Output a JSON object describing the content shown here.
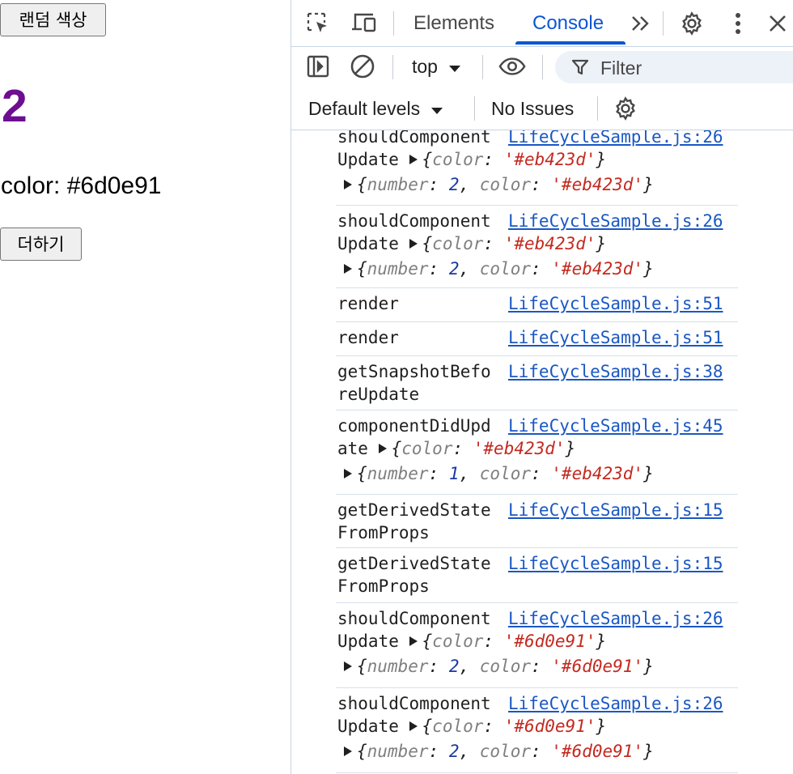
{
  "app": {
    "random_color_button": "랜덤 색상",
    "number": "2",
    "number_color": "#6d0e91",
    "color_label": "color: #6d0e91",
    "add_button": "더하기"
  },
  "devtools": {
    "tabs": [
      "Elements",
      "Console"
    ],
    "active_tab": "Console",
    "context": "top",
    "filter_placeholder": "Filter",
    "default_levels": "Default levels",
    "issues": "No Issues",
    "accent_color": "#0b57d0",
    "icons": [
      "inspect-element-icon",
      "device-toolbar-icon",
      "more-tabs-icon",
      "settings-icon",
      "more-options-icon",
      "close-icon",
      "sidebar-toggle-icon",
      "clear-console-icon",
      "live-expression-eye-icon",
      "filter-icon",
      "console-settings-icon"
    ]
  },
  "console": {
    "messages": [
      {
        "kind": "shouldComponentUpdate",
        "line1": "shouldComponent",
        "line2": "Update",
        "source": "LifeCycleSample.js:26",
        "props_obj": {
          "key": "color",
          "value": "'#eb423d'"
        },
        "state_obj": [
          {
            "key": "number",
            "value": "2"
          },
          {
            "key": "color",
            "value": "'#eb423d'"
          }
        ]
      },
      {
        "kind": "shouldComponentUpdate",
        "line1": "shouldComponent",
        "line2": "Update",
        "source": "LifeCycleSample.js:26",
        "props_obj": {
          "key": "color",
          "value": "'#eb423d'"
        },
        "state_obj": [
          {
            "key": "number",
            "value": "2"
          },
          {
            "key": "color",
            "value": "'#eb423d'"
          }
        ]
      },
      {
        "kind": "render",
        "line1": "render",
        "source": "LifeCycleSample.js:51"
      },
      {
        "kind": "render",
        "line1": "render",
        "source": "LifeCycleSample.js:51"
      },
      {
        "kind": "getSnapshotBeforeUpdate",
        "line1": "getSnapshotBefo",
        "line2": "reUpdate",
        "source": "LifeCycleSample.js:38"
      },
      {
        "kind": "componentDidUpdate",
        "line1": "componentDidUpd",
        "line2": "ate",
        "source": "LifeCycleSample.js:45",
        "props_obj": {
          "key": "color",
          "value": "'#eb423d'"
        },
        "state_obj": [
          {
            "key": "number",
            "value": "1"
          },
          {
            "key": "color",
            "value": "'#eb423d'"
          }
        ]
      },
      {
        "kind": "getDerivedStateFromProps",
        "line1": "getDerivedState",
        "line2": "FromProps",
        "source": "LifeCycleSample.js:15"
      },
      {
        "kind": "getDerivedStateFromProps",
        "line1": "getDerivedState",
        "line2": "FromProps",
        "source": "LifeCycleSample.js:15"
      },
      {
        "kind": "shouldComponentUpdate",
        "line1": "shouldComponent",
        "line2": "Update",
        "source": "LifeCycleSample.js:26",
        "props_obj": {
          "key": "color",
          "value": "'#6d0e91'"
        },
        "state_obj": [
          {
            "key": "number",
            "value": "2"
          },
          {
            "key": "color",
            "value": "'#6d0e91'"
          }
        ]
      },
      {
        "kind": "shouldComponentUpdate",
        "line1": "shouldComponent",
        "line2": "Update",
        "source": "LifeCycleSample.js:26",
        "props_obj": {
          "key": "color",
          "value": "'#6d0e91'"
        },
        "state_obj": [
          {
            "key": "number",
            "value": "2"
          },
          {
            "key": "color",
            "value": "'#6d0e91'"
          }
        ]
      }
    ]
  }
}
